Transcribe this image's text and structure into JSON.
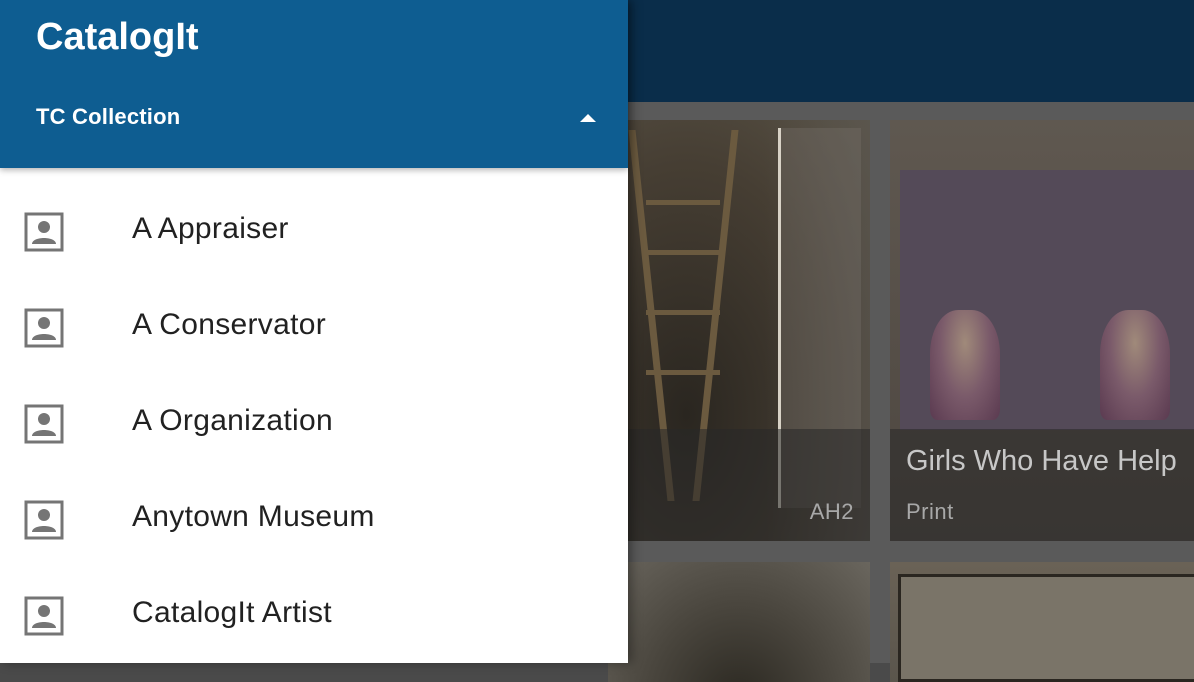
{
  "app": {
    "title": "CatalogIt"
  },
  "drawer": {
    "collection": {
      "label": "TC Collection",
      "expanded": true
    },
    "items": [
      {
        "label": "A Appraiser",
        "icon": "contact-card-icon"
      },
      {
        "label": "A Conservator",
        "icon": "contact-card-icon"
      },
      {
        "label": "A Organization",
        "icon": "contact-card-icon"
      },
      {
        "label": "Anytown Museum",
        "icon": "contact-card-icon"
      },
      {
        "label": "CatalogIt Artist",
        "icon": "contact-card-icon"
      }
    ]
  },
  "grid": {
    "cards": [
      {
        "title": "",
        "subtitle": "",
        "code": "AH2"
      },
      {
        "title": "Girls Who Have Help",
        "subtitle": "Print",
        "code": ""
      }
    ]
  },
  "colors": {
    "header": "#0e5d91",
    "appbar": "#0a2d4a",
    "icon": "#757575"
  }
}
